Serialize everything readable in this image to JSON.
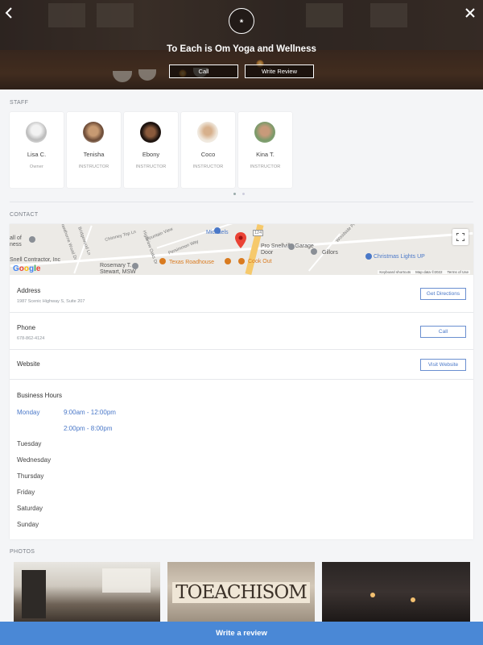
{
  "header": {
    "title": "To Each is Om Yoga and Wellness",
    "call_label": "Call",
    "review_label": "Write Review",
    "back_icon": "chevron-left-icon",
    "close_icon": "close-icon"
  },
  "staff": {
    "section_label": "STAFF",
    "members": [
      {
        "name": "Lisa C.",
        "role": "Owner"
      },
      {
        "name": "Tenisha",
        "role": "INSTRUCTOR"
      },
      {
        "name": "Ebony",
        "role": "INSTRUCTOR"
      },
      {
        "name": "Coco",
        "role": "INSTRUCTOR"
      },
      {
        "name": "Kina T.",
        "role": "INSTRUCTOR"
      }
    ]
  },
  "contact": {
    "section_label": "CONTACT",
    "map": {
      "labels": [
        "Michaels",
        "Pro Snellville Garage Door",
        "Gillors",
        "Christmas Lights UP",
        "Texas Roadhouse",
        "Cook Out",
        "Snell Contractor, Inc",
        "Rosemary T. Stewart, MSW",
        "all of ness",
        "124"
      ],
      "streets": [
        "Chimney Top Ln",
        "Mountain View",
        "Bridgewood Ln",
        "Persimmon Way",
        "Highview Oaks Dr",
        "Hawthorne Wood Dr",
        "Woodside Pl"
      ],
      "footer": [
        "Keyboard shortcuts",
        "Map data ©2022",
        "Terms of Use"
      ],
      "google": "Google"
    },
    "address": {
      "title": "Address",
      "value": "1987 Scenic Highway S, Suite 207",
      "button": "Get Directions"
    },
    "phone": {
      "title": "Phone",
      "value": "678-862-4124",
      "button": "Call"
    },
    "website": {
      "title": "Website",
      "button": "Visit Website"
    },
    "hours": {
      "title": "Business Hours",
      "days": [
        "Monday",
        "Tuesday",
        "Wednesday",
        "Thursday",
        "Friday",
        "Saturday",
        "Sunday"
      ],
      "monday_slots": [
        "9:00am - 12:00pm",
        "2:00pm - 8:00pm"
      ]
    }
  },
  "photos": {
    "section_label": "PHOTOS",
    "sign_text": "TOEACHISOM"
  },
  "footer": {
    "write_review": "Write a review"
  },
  "colors": {
    "accent": "#4a78c8",
    "bottom_bar": "#4a88d6"
  }
}
